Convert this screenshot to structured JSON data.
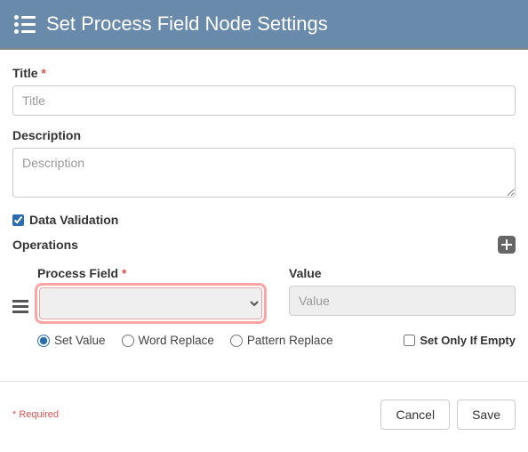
{
  "header": {
    "title": "Set Process Field Node Settings"
  },
  "fields": {
    "title_label": "Title",
    "title_placeholder": "Title",
    "desc_label": "Description",
    "desc_placeholder": "Description",
    "data_validation_label": "Data Validation"
  },
  "operations": {
    "heading": "Operations",
    "process_field_label": "Process Field",
    "value_label": "Value",
    "value_placeholder": "Value",
    "radios": {
      "set_value": "Set Value",
      "word_replace": "Word Replace",
      "pattern_replace": "Pattern Replace"
    },
    "set_only_label": "Set Only If Empty"
  },
  "footer": {
    "required_note": "* Required",
    "cancel": "Cancel",
    "save": "Save"
  },
  "required_marker": "*"
}
